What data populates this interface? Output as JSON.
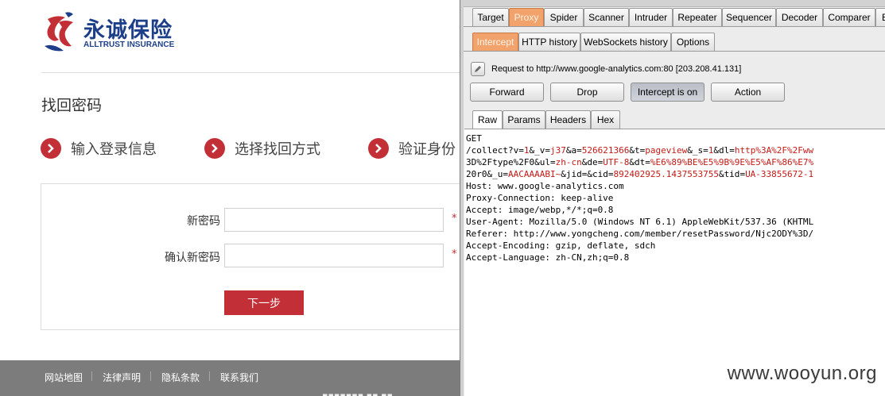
{
  "site": {
    "logo_cn": "永诚保险",
    "logo_en": "ALLTRUST INSURANCE",
    "page_title": "找回密码",
    "steps": [
      "输入登录信息",
      "选择找回方式",
      "验证身份"
    ],
    "form": {
      "new_password_label": "新密码",
      "confirm_password_label": "确认新密码",
      "required_mark": "*",
      "next_button": "下一步"
    },
    "footer": {
      "links": [
        "网站地图",
        "法律声明",
        "隐私条款",
        "联系我们"
      ],
      "partial_text": "▪▪▪▪▪▪▪ ▪▪ ▪▪"
    },
    "colors": {
      "brand_red": "#c32f36",
      "brand_blue": "#1d3f8a",
      "footer_gray": "#7c7c7c"
    }
  },
  "burp": {
    "main_tabs": [
      "Target",
      "Proxy",
      "Spider",
      "Scanner",
      "Intruder",
      "Repeater",
      "Sequencer",
      "Decoder",
      "Comparer",
      "E"
    ],
    "active_main_tab": "Proxy",
    "sub_tabs": [
      "Intercept",
      "HTTP history",
      "WebSockets history",
      "Options"
    ],
    "active_sub_tab": "Intercept",
    "request_info": "Request to http://www.google-analytics.com:80  [203.208.41.131]",
    "buttons": {
      "forward": "Forward",
      "drop": "Drop",
      "intercept": "Intercept is on",
      "action": "Action"
    },
    "view_tabs": [
      "Raw",
      "Params",
      "Headers",
      "Hex"
    ],
    "active_view_tab": "Raw",
    "request_lines": [
      "GET",
      "/collect?v=1&_v=j37&a=526621366&t=pageview&_s=1&dl=http%3A%2F%2Fww",
      "3D%2Ftype%2F0&ul=zh-cn&de=UTF-8&dt=%E6%89%BE%E5%9B%9E%E5%AF%86%E7%",
      "20r0&_u=AACAAAABI~&jid=&cid=892402925.1437553755&tid=UA-33855672-1",
      "Host: www.google-analytics.com",
      "Proxy-Connection: keep-alive",
      "Accept: image/webp,*/*;q=0.8",
      "User-Agent: Mozilla/5.0 (Windows NT 6.1) AppleWebKit/537.36 (KHTML",
      "Referer: http://www.yongcheng.com/member/resetPassword/Njc2ODY%3D/",
      "Accept-Encoding: gzip, deflate, sdch",
      "Accept-Language: zh-CN,zh;q=0.8"
    ],
    "colors": {
      "active_tab_orange": "#f2a26b",
      "param_value_red": "#c41a16"
    }
  },
  "watermark": "www.wooyun.org",
  "icons": [
    "logo-mark-icon",
    "arrow-right-circle-icon",
    "edit-pencil-icon"
  ]
}
